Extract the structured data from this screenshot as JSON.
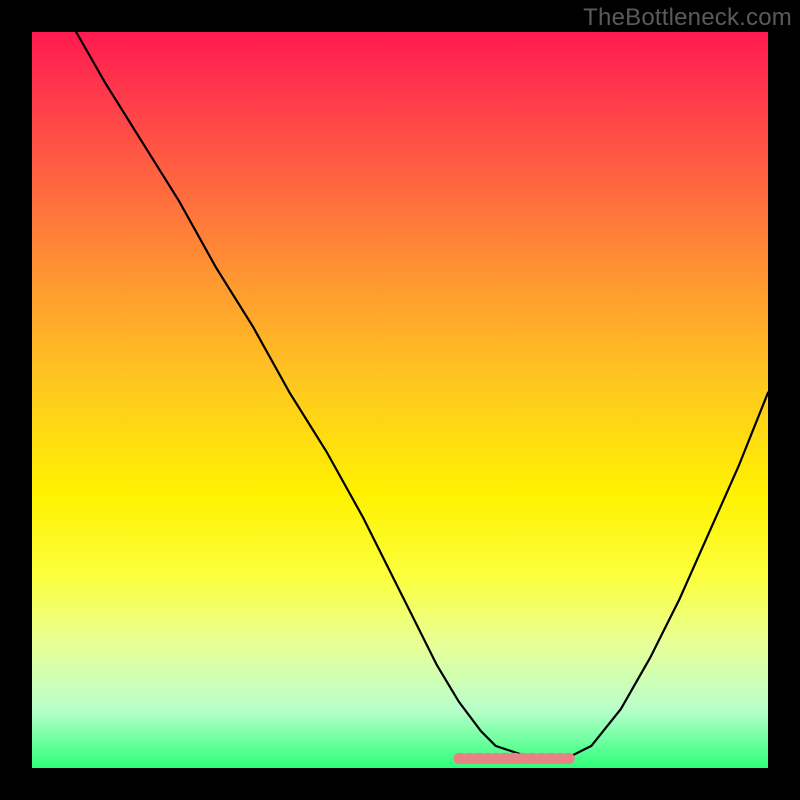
{
  "attribution": "TheBottleneck.com",
  "colors": {
    "page_bg": "#000000",
    "attribution_text": "#5a5a5a",
    "curve_stroke": "#000000",
    "flat_marker": "#e88383",
    "gradient_stops": [
      "#ff1a50",
      "#ff3f4a",
      "#ff6f3e",
      "#ff9c2f",
      "#ffc81f",
      "#fff200",
      "#fbff3e",
      "#e9ff96",
      "#b9ffca",
      "#2dff7a"
    ]
  },
  "chart_data": {
    "type": "line",
    "title": "",
    "xlabel": "",
    "ylabel": "",
    "xlim": [
      0,
      100
    ],
    "ylim": [
      0,
      100
    ],
    "x": [
      6,
      10,
      15,
      20,
      25,
      30,
      35,
      40,
      45,
      50,
      52,
      55,
      58,
      61,
      63,
      66,
      68,
      70,
      73,
      76,
      80,
      84,
      88,
      92,
      96,
      100
    ],
    "values": [
      100,
      93,
      85,
      77,
      68,
      60,
      51,
      43,
      34,
      24,
      20,
      14,
      9,
      5,
      3,
      2,
      1.4,
      1.2,
      1.5,
      3,
      8,
      15,
      23,
      32,
      41,
      51
    ],
    "flat_region": {
      "x_start": 58,
      "x_end": 73,
      "y": 1.3
    },
    "annotations": []
  }
}
